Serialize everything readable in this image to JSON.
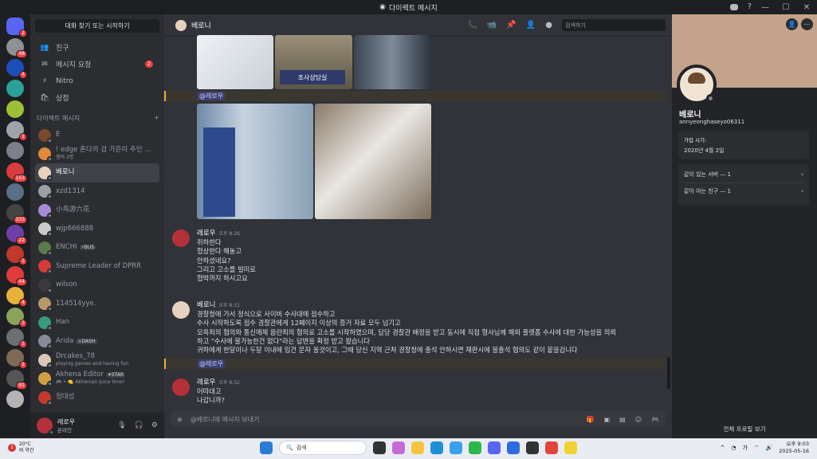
{
  "window": {
    "title": "다이렉트 메시지",
    "controls": [
      "—",
      "☐",
      "✕"
    ]
  },
  "guilds": [
    {
      "color": "#5865f2",
      "badge": "2"
    },
    {
      "color": "#8e9297",
      "badge": "48"
    },
    {
      "color": "#1d4fb8",
      "badge": "4"
    },
    {
      "color": "#2aa198",
      "badge": ""
    },
    {
      "color": "#9fbf3a",
      "badge": ""
    },
    {
      "color": "#a0a4aa",
      "badge": "1"
    },
    {
      "color": "#7c808a",
      "badge": ""
    },
    {
      "color": "#d83c3e",
      "badge": "163"
    },
    {
      "color": "#5b6f86",
      "badge": ""
    },
    {
      "color": "#444",
      "badge": "333"
    },
    {
      "color": "#6f3fa8",
      "badge": "22"
    },
    {
      "color": "#c0392b",
      "badge": "1"
    },
    {
      "color": "#e03a3a",
      "badge": "44"
    },
    {
      "color": "#e6b23a",
      "badge": "4"
    },
    {
      "color": "#8aa35a",
      "badge": "3"
    },
    {
      "color": "#6b6e72",
      "badge": "1"
    },
    {
      "color": "#7f6a55",
      "badge": "1"
    },
    {
      "color": "#555",
      "badge": "91"
    },
    {
      "color": "#b4b4b4",
      "badge": ""
    }
  ],
  "sidebar": {
    "search": "대화 찾기 또는 시작하기",
    "nav": [
      {
        "label": "친구",
        "icon": "👥",
        "badge": ""
      },
      {
        "label": "메시지 요청",
        "icon": "✉",
        "badge": "2"
      },
      {
        "label": "Nitro",
        "icon": "⚡",
        "badge": ""
      },
      {
        "label": "상점",
        "icon": "🛍",
        "badge": ""
      }
    ],
    "dm_header": "다이렉트 메시지",
    "dm_plus": "+",
    "dms": [
      {
        "name": "E",
        "sub": "",
        "tag": "",
        "color": "#7a4a2a",
        "active": false
      },
      {
        "name": "! edge 촌다의 검 가은이 주인 ...",
        "sub": "멤버 2명",
        "tag": "",
        "color": "#e08a3a",
        "active": false
      },
      {
        "name": "베로니",
        "sub": "",
        "tag": "",
        "color": "#e6d2bd",
        "active": true
      },
      {
        "name": "xzd1314",
        "sub": "",
        "tag": "",
        "color": "#9aa0a6",
        "active": false
      },
      {
        "name": "小鸟游六花",
        "sub": "",
        "tag": "",
        "color": "#a88bd6",
        "active": false
      },
      {
        "name": "wjp666888",
        "sub": "",
        "tag": "",
        "color": "#c9c9c9",
        "active": false
      },
      {
        "name": "ENCHI",
        "sub": "",
        "tag": "⚡BUS",
        "color": "#5c7a4a",
        "active": false
      },
      {
        "name": "Supreme Leader of DPRR",
        "sub": "",
        "tag": "",
        "color": "#d63a3a",
        "active": false
      },
      {
        "name": "wilson",
        "sub": "",
        "tag": "",
        "color": "#3a3a3a",
        "active": false
      },
      {
        "name": "114514yye.",
        "sub": "",
        "tag": "",
        "color": "#b89a6a",
        "active": false
      },
      {
        "name": "Han",
        "sub": "",
        "tag": "",
        "color": "#3a9a7a",
        "active": false
      },
      {
        "name": "Arida",
        "sub": "",
        "tag": "⚔DASH",
        "color": "#8a8a9a",
        "active": false
      },
      {
        "name": "Drcakes_78",
        "sub": "playing games and having fun",
        "tag": "",
        "color": "#d8c8b8",
        "active": false
      },
      {
        "name": "Akhena Editor",
        "sub": "🎮 • 🍋 Akhenian Juice time!",
        "tag": "✦STAR",
        "color": "#d0a040",
        "active": false
      },
      {
        "name": "정대성",
        "sub": "",
        "tag": "",
        "color": "#c0392b",
        "active": false
      }
    ],
    "user": {
      "name": "레로우",
      "status": "온라인"
    }
  },
  "chat": {
    "name": "베로니",
    "search_placeholder": "검색하기",
    "mention": "@레로우",
    "image_text": "조사상담실",
    "messages": [
      {
        "author": "레로우",
        "time": "오후 8:26",
        "lines": [
          "쥐하한다",
          "협상한다 해놓고",
          "안하셨네요?",
          "그리고 고소를 빌미로",
          "협박까지 하시고요"
        ],
        "color": "#b4313a"
      },
      {
        "author": "베로니",
        "time": "오후 8:31",
        "lines": [
          "경찰청에 가서 정식으로 사이버 수사대에 접수하고",
          "수사 시작하도록 접수 경찰관에게 12페이지 이상의 증거 자료 모두 넘기고",
          "모욕죄의 혐의와 통신매체 음란죄의 혐의로 고소를 시작하였으며, 담당 경찰관 배정을 받고 동시에 직접 형사님께 해외 플랫폼 수사에 대한 가능성을 의뢰",
          "하고 \"수사에 불가능한건 없다\"라는 답변을 확정 받고 왔습니다",
          "귀하에게 한달이나 두달 이내에 입건 문자 올것이고, 그때 당신 지역 근처 경찰청에 출석 안하시면 재판시에 불출석 혐의도 같이 붙을겁니다"
        ],
        "color": "#e6d2bd"
      },
      {
        "author": "레로우",
        "time": "오후 8:32",
        "lines": [
          "어따대고",
          "나갑니까?"
        ],
        "color": "#b4313a"
      }
    ],
    "composer_placeholder": "@베로니에 메시지 보내기"
  },
  "profile": {
    "name": "베로니",
    "handle": "annyeonghaseyo06311",
    "joined_label": "가입 시기:",
    "joined_value": "2020년 4월 2일",
    "mutual_servers": "같이 있는 서버 — 1",
    "mutual_friends": "같이 아는 친구 — 1",
    "full_profile": "전체 프로필 보기"
  },
  "taskbar": {
    "weather_temp": "20°C",
    "weather_desc": "비 약간",
    "weather_badge": "1",
    "search": "검색",
    "tray_lang": "가",
    "time": "오후 9:03",
    "date": "2025-05-16"
  }
}
